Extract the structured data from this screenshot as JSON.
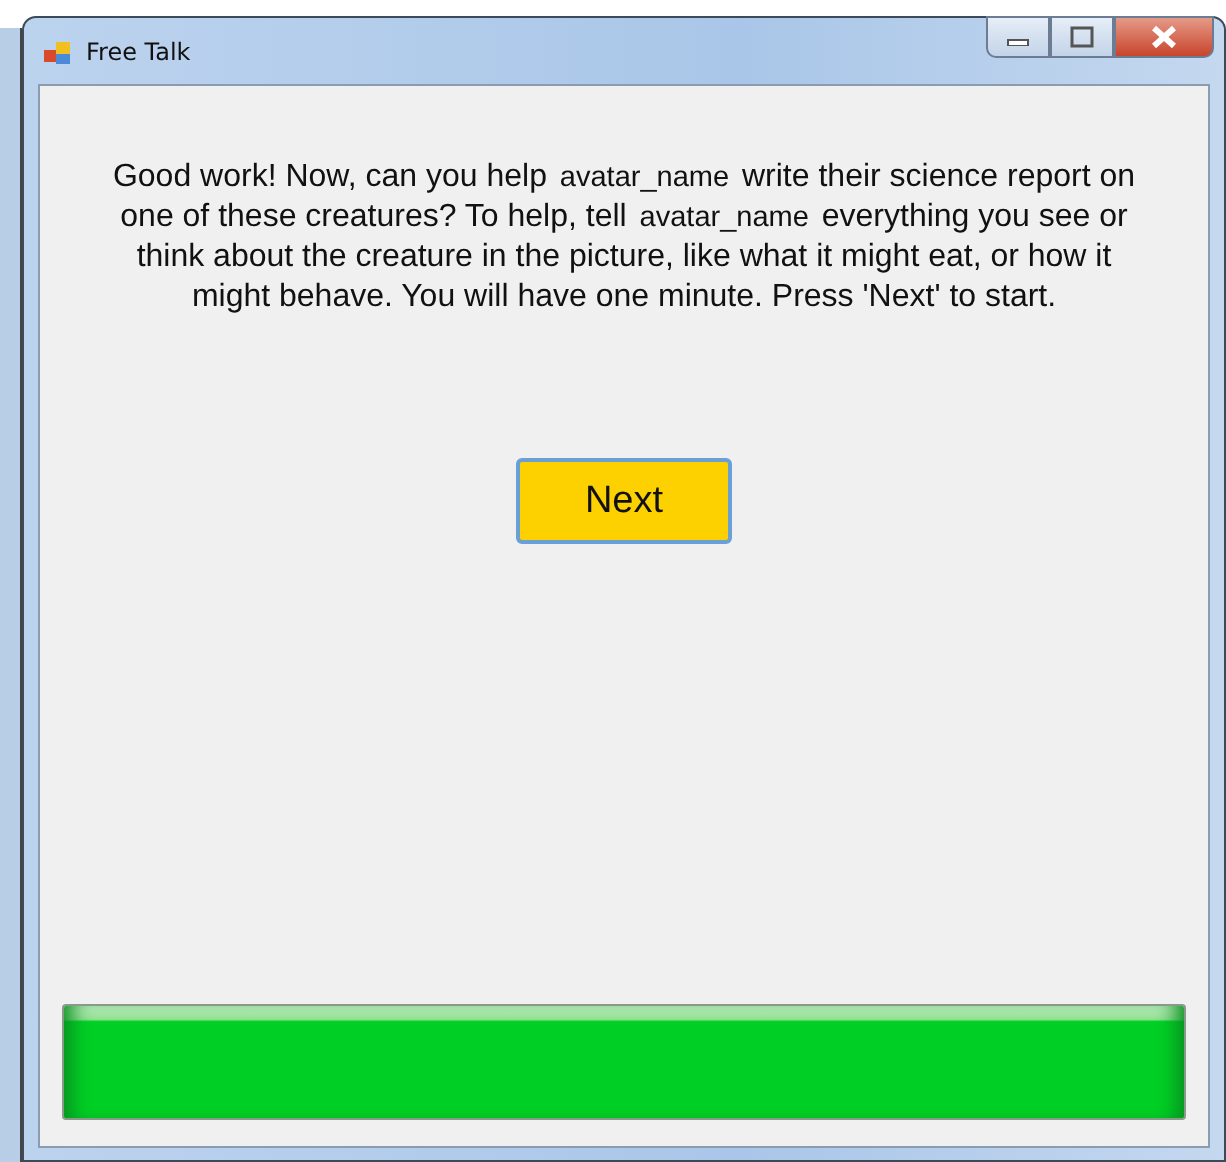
{
  "window": {
    "title": "Free Talk"
  },
  "message": [
    {
      "kind": "plain",
      "text": "Good work! Now, can you help "
    },
    {
      "kind": "name",
      "text": "avatar_name"
    },
    {
      "kind": "plain",
      "text": " write their science report on one of these creatures? To help, tell "
    },
    {
      "kind": "name",
      "text": "avatar_name"
    },
    {
      "kind": "plain",
      "text": " everything you see or think about the creature in the picture, like what it might eat, or how it might behave. You will have one minute. Press 'Next' to start."
    }
  ],
  "next_button": {
    "label": "Next"
  },
  "progress": {
    "level": 1
  }
}
